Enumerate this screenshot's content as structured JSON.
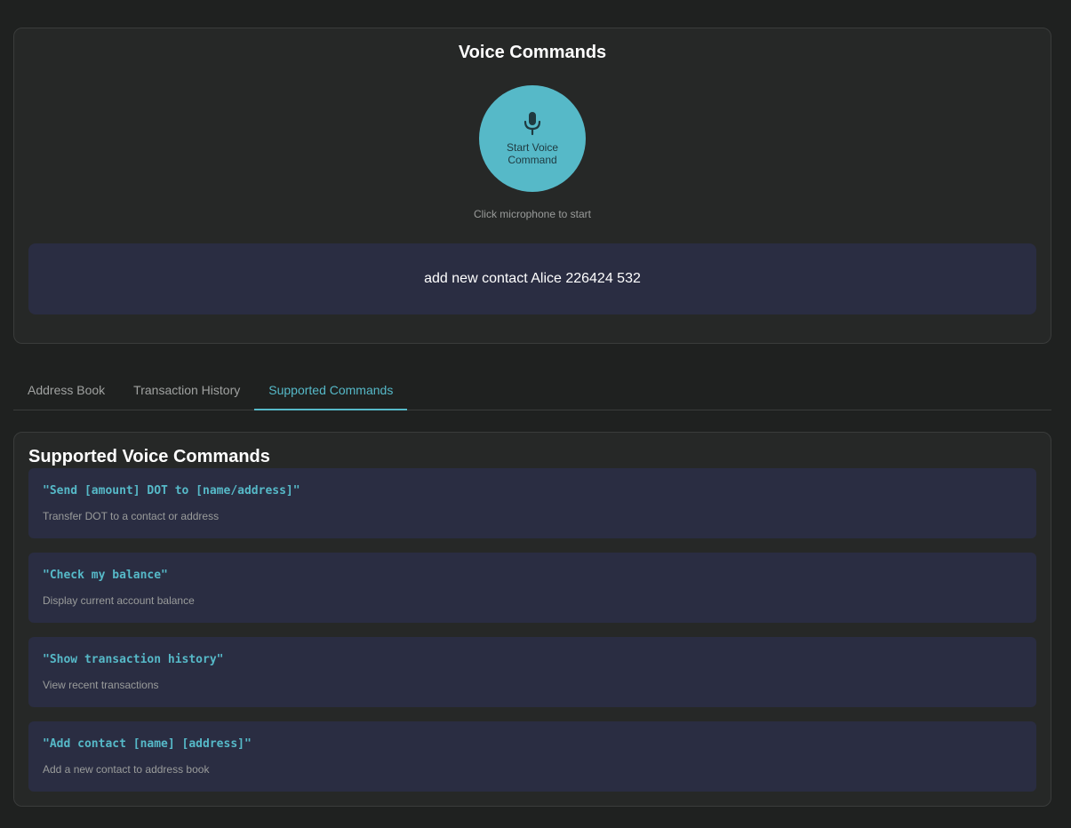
{
  "voice": {
    "title": "Voice Commands",
    "mic_label_line1": "Start Voice",
    "mic_label_line2": "Command",
    "hint": "Click microphone to start",
    "transcript": "add new contact Alice 226424 532"
  },
  "tabs": [
    {
      "label": "Address Book"
    },
    {
      "label": "Transaction History"
    },
    {
      "label": "Supported Commands"
    }
  ],
  "commands": {
    "title": "Supported Voice Commands",
    "items": [
      {
        "command": "\"Send [amount] DOT to [name/address]\"",
        "description": "Transfer DOT to a contact or address"
      },
      {
        "command": "\"Check my balance\"",
        "description": "Display current account balance"
      },
      {
        "command": "\"Show transaction history\"",
        "description": "View recent transactions"
      },
      {
        "command": "\"Add contact [name] [address]\"",
        "description": "Add a new contact to address book"
      }
    ]
  },
  "colors": {
    "accent": "#56b9c8",
    "card": "#2a2d42",
    "panel": "#262827",
    "background": "#1f2120"
  },
  "icons": {
    "mic": "microphone-icon"
  }
}
